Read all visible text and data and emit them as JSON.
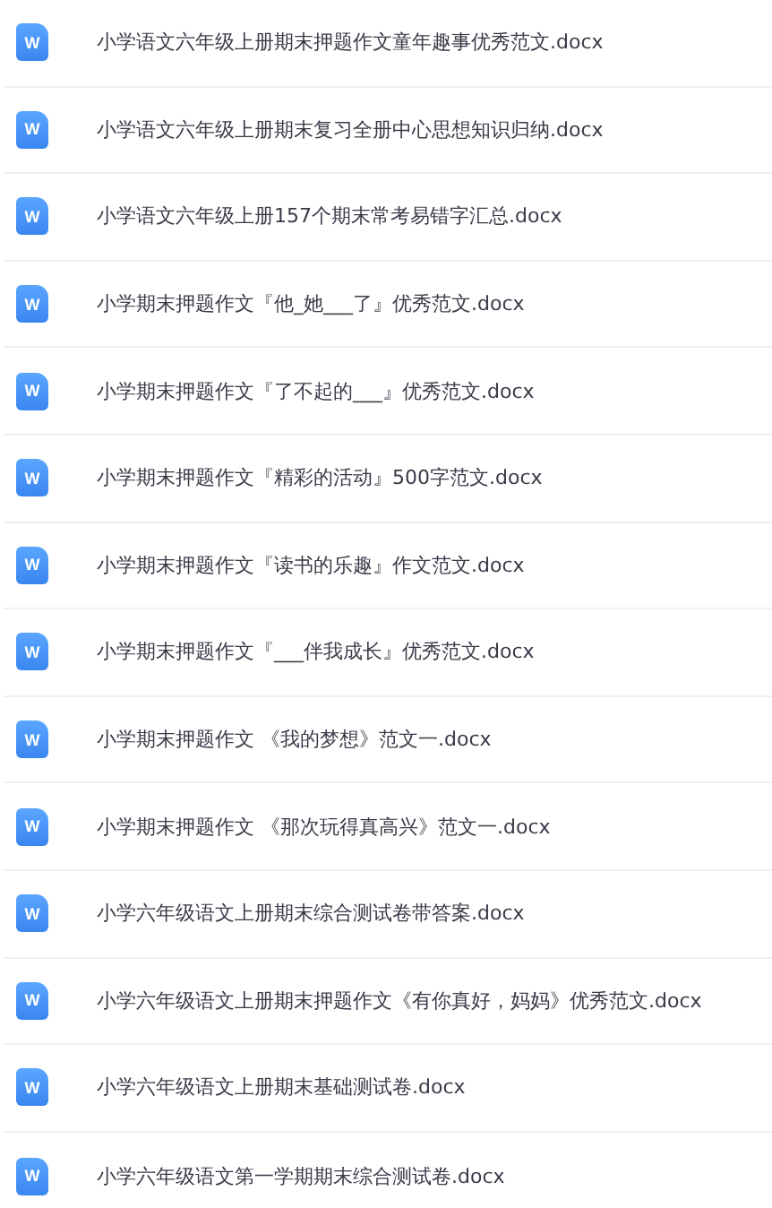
{
  "files": [
    {
      "name": "小学语文六年级上册期末押题作文童年趣事优秀范文.docx",
      "icon_label": "W"
    },
    {
      "name": "小学语文六年级上册期末复习全册中心思想知识归纳.docx",
      "icon_label": "W"
    },
    {
      "name": "小学语文六年级上册157个期末常考易错字汇总.docx",
      "icon_label": "W"
    },
    {
      "name": "小学期末押题作文『他_她___了』优秀范文.docx",
      "icon_label": "W"
    },
    {
      "name": "小学期末押题作文『了不起的___』优秀范文.docx",
      "icon_label": "W"
    },
    {
      "name": "小学期末押题作文『精彩的活动』500字范文.docx",
      "icon_label": "W"
    },
    {
      "name": "小学期末押题作文『读书的乐趣』作文范文.docx",
      "icon_label": "W"
    },
    {
      "name": "小学期末押题作文『___伴我成长』优秀范文.docx",
      "icon_label": "W"
    },
    {
      "name": "小学期末押题作文 《我的梦想》范文一.docx",
      "icon_label": "W"
    },
    {
      "name": "小学期末押题作文 《那次玩得真高兴》范文一.docx",
      "icon_label": "W"
    },
    {
      "name": "小学六年级语文上册期末综合测试卷带答案.docx",
      "icon_label": "W"
    },
    {
      "name": "小学六年级语文上册期末押题作文《有你真好，妈妈》优秀范文.docx",
      "icon_label": "W"
    },
    {
      "name": "小学六年级语文上册期末基础测试卷.docx",
      "icon_label": "W"
    },
    {
      "name": "小学六年级语文第一学期期末综合测试卷.docx",
      "icon_label": "W"
    }
  ]
}
